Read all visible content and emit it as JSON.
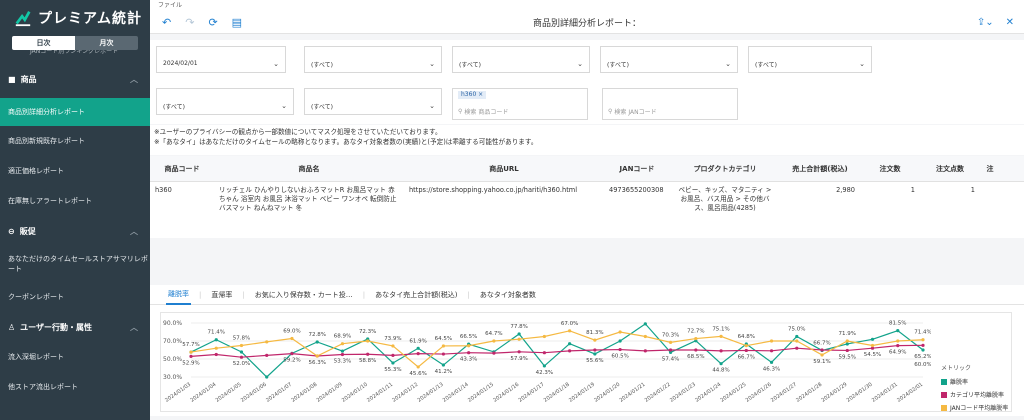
{
  "app": {
    "logo_text": "プレミアム統計"
  },
  "sidebar": {
    "toggle": {
      "daily": "日次",
      "monthly": "月次"
    },
    "cut_item": "JANコード別ランキングレポート",
    "sections": [
      {
        "label": "商品",
        "items": [
          "商品別詳細分析レポート",
          "商品別新規既存レポート",
          "適正価格レポート",
          "在庫無しアラートレポート"
        ]
      },
      {
        "label": "販促",
        "items": [
          "あなただけのタイムセールストアサマリレポート",
          "クーポンレポート"
        ]
      },
      {
        "label": "ユーザー行動・属性",
        "items": [
          "流入深堀レポート",
          "他ストア流出レポート"
        ]
      }
    ]
  },
  "menubar": {
    "file": "ファイル"
  },
  "toolbar": {
    "title": "商品別詳細分析レポート："
  },
  "filters": {
    "date": "2024/02/01",
    "all": "(すべて)",
    "tag": "h360",
    "search_product": "検索 商品コード",
    "search_jan": "検索 JANコード"
  },
  "notices": [
    "※ユーザーのプライバシーの観点から一部数値についてマスク処理をさせていただいております。",
    "※「あなタイ」はあなただけのタイムセールの略称となります。あなタイ対象者数の(実績)と(予定)は乖離する可能性があります。"
  ],
  "table": {
    "headers": [
      "商品コード",
      "商品名",
      "商品URL",
      "JANコード",
      "プロダクトカテゴリ",
      "売上合計額(税込)",
      "注文数",
      "注文点数",
      "注"
    ],
    "row": [
      "h360",
      "リッチェル ひんやりしないおふろマットR お風呂マット 赤ちゃん 浴室内 お風呂 沐浴マット ベビー ワンオペ 転倒防止 バスマット ねんねマット 冬",
      "https://store.shopping.yahoo.co.jp/hariti/h360.html",
      "4973655200308",
      "ベビー、キッズ、マタニティ > お風呂、バス用品 > その他バス、風呂用品(4285)",
      "2,980",
      "1",
      "1",
      ""
    ]
  },
  "chart_tabs": [
    "離脱率",
    "直帰率",
    "お気に入り保存数・カート投…",
    "あなタイ売上合計額(税込)",
    "あなタイ対象者数"
  ],
  "chart_data": {
    "type": "line",
    "x": [
      "2024/01/03",
      "2024/01/04",
      "2024/01/05",
      "2024/01/06",
      "2024/01/07",
      "2024/01/08",
      "2024/01/09",
      "2024/01/10",
      "2024/01/11",
      "2024/01/12",
      "2024/01/13",
      "2024/01/14",
      "2024/01/15",
      "2024/01/16",
      "2024/01/17",
      "2024/01/18",
      "2024/01/19",
      "2024/01/20",
      "2024/01/21",
      "2024/01/22",
      "2024/01/23",
      "2024/01/24",
      "2024/01/25",
      "2024/01/26",
      "2024/01/27",
      "2024/01/28",
      "2024/01/29",
      "2024/01/30",
      "2024/01/31",
      "2024/02/01"
    ],
    "yticks": [
      "90.0%",
      "70.0%",
      "50.0%",
      "30.0%"
    ],
    "ylim": [
      30,
      90
    ],
    "legend_title": "メトリック",
    "series": [
      {
        "name": "離脱率",
        "color": "#12a38b",
        "values": [
          57.7,
          71.4,
          57.8,
          30.0,
          56.3,
          68.9,
          58.8,
          72.3,
          45.6,
          61.9,
          43.3,
          66.5,
          57.9,
          77.8,
          42.3,
          67.0,
          55.6,
          70.0,
          89.0,
          57.4,
          70.3,
          44.8,
          66.7,
          46.3,
          75.0,
          59.5,
          66.7,
          71.9,
          81.5,
          60.0
        ]
      },
      {
        "name": "カテゴリ平均離脱率",
        "color": "#c0266b",
        "values": [
          52.9,
          55.0,
          52.0,
          54.0,
          56.0,
          53.3,
          55.0,
          55.3,
          54.0,
          56.0,
          55.5,
          57.0,
          56.5,
          58.0,
          57.0,
          59.0,
          60.0,
          60.5,
          59.0,
          60.0,
          60.0,
          59.0,
          59.5,
          59.1,
          62.0,
          60.0,
          59.5,
          62.0,
          64.9,
          65.2
        ]
      },
      {
        "name": "JANコード平均離脱率",
        "color": "#f5b942",
        "values": [
          57.7,
          62.0,
          65.0,
          69.0,
          72.8,
          53.3,
          67.0,
          70.0,
          64.5,
          41.2,
          64.5,
          64.7,
          70.0,
          72.0,
          75.0,
          81.3,
          71.0,
          80.0,
          75.0,
          68.5,
          72.7,
          75.1,
          64.8,
          70.0,
          70.0,
          54.5,
          70.0,
          65.0,
          70.0,
          71.4
        ]
      }
    ],
    "labels": [
      {
        "i": 0,
        "text": "57.7%",
        "dy": -6
      },
      {
        "i": 1,
        "text": "71.4%",
        "dy": -6
      },
      {
        "i": 2,
        "text": "57.8%",
        "dy": -6
      },
      {
        "i": 4,
        "text": "69.0%",
        "dy": -6
      },
      {
        "i": 5,
        "text": "72.8%",
        "dy": -6
      },
      {
        "i": 6,
        "text": "68.9%",
        "dy": -6
      },
      {
        "i": 7,
        "text": "72.3%",
        "dy": -6
      },
      {
        "i": 8,
        "text": "73.9%",
        "dy": -6
      },
      {
        "i": 9,
        "text": "61.9%",
        "dy": -6
      },
      {
        "i": 10,
        "text": "64.5%",
        "dy": -6
      },
      {
        "i": 11,
        "text": "66.5%",
        "dy": -6
      },
      {
        "i": 12,
        "text": "64.7%",
        "dy": -6
      },
      {
        "i": 13,
        "text": "77.8%",
        "dy": -6
      },
      {
        "i": 15,
        "text": "67.0%",
        "dy": -6
      },
      {
        "i": 16,
        "text": "81.3%",
        "dy": -6
      },
      {
        "i": 19,
        "text": "70.3%",
        "dy": -6
      },
      {
        "i": 20,
        "text": "72.7%",
        "dy": -6
      },
      {
        "i": 21,
        "text": "75.1%",
        "dy": -6
      },
      {
        "i": 22,
        "text": "64.8%",
        "dy": -6
      },
      {
        "i": 24,
        "text": "75.0%",
        "dy": -6
      },
      {
        "i": 25,
        "text": "66.7%",
        "dy": -6
      },
      {
        "i": 26,
        "text": "71.9%",
        "dy": -6
      },
      {
        "i": 28,
        "text": "81.5%",
        "dy": -6
      },
      {
        "i": 29,
        "text": "71.4%",
        "dy": -6
      },
      {
        "i": 0,
        "text": "52.9%",
        "dy": 8
      },
      {
        "i": 2,
        "text": "52.0%",
        "dy": 8
      },
      {
        "i": 4,
        "text": "59.2%",
        "dy": 8
      },
      {
        "i": 5,
        "text": "56.3%",
        "dy": 8
      },
      {
        "i": 6,
        "text": "53.3%",
        "dy": 8
      },
      {
        "i": 7,
        "text": "58.8%",
        "dy": 8
      },
      {
        "i": 8,
        "text": "55.3%",
        "dy": 8
      },
      {
        "i": 9,
        "text": "45.6%",
        "dy": 8
      },
      {
        "i": 10,
        "text": "41.2%",
        "dy": 8
      },
      {
        "i": 11,
        "text": "43.3%",
        "dy": 8
      },
      {
        "i": 13,
        "text": "57.9%",
        "dy": 8
      },
      {
        "i": 14,
        "text": "42.3%",
        "dy": 8
      },
      {
        "i": 16,
        "text": "55.6%",
        "dy": 8
      },
      {
        "i": 17,
        "text": "60.5%",
        "dy": 8
      },
      {
        "i": 19,
        "text": "57.4%",
        "dy": 8
      },
      {
        "i": 20,
        "text": "68.5%",
        "dy": 8
      },
      {
        "i": 21,
        "text": "44.8%",
        "dy": 8
      },
      {
        "i": 22,
        "text": "66.7%",
        "dy": 8
      },
      {
        "i": 23,
        "text": "46.3%",
        "dy": 8
      },
      {
        "i": 25,
        "text": "59.1%",
        "dy": 8
      },
      {
        "i": 26,
        "text": "59.5%",
        "dy": 8
      },
      {
        "i": 27,
        "text": "54.5%",
        "dy": 8
      },
      {
        "i": 28,
        "text": "64.9%",
        "dy": 8
      },
      {
        "i": 29,
        "text": "65.2%",
        "dy": 8
      },
      {
        "i": 29,
        "text": "60.0%",
        "dy": 16
      }
    ]
  },
  "colors": {
    "sidebar_bg": "#2e3d47",
    "accent": "#12a38b",
    "link": "#1f7fd0"
  }
}
